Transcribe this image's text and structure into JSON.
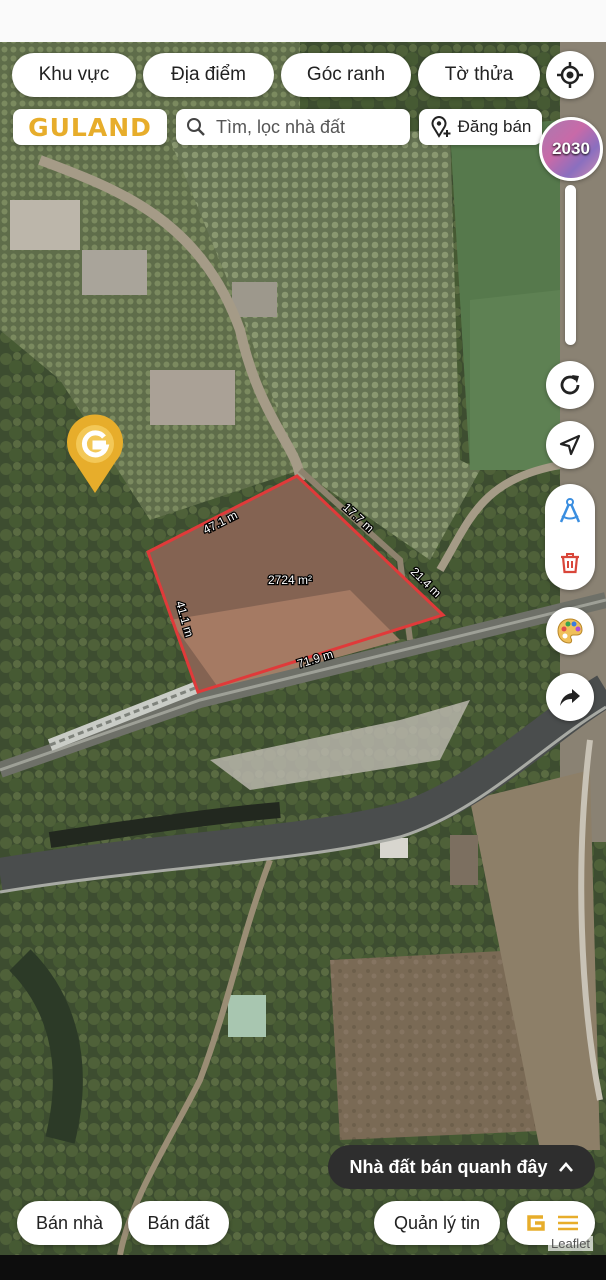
{
  "filters": {
    "region": "Khu vực",
    "location": "Địa điểm",
    "boundary": "Góc ranh",
    "parcel": "Tờ thửa"
  },
  "brand": {
    "logo_text": "GULAND"
  },
  "search": {
    "placeholder": "Tìm, lọc nhà đất"
  },
  "post_listing": {
    "label": "Đăng bán"
  },
  "planning_layer": {
    "label": "2030"
  },
  "parcel": {
    "area_label": "2724 m²",
    "edges": [
      "47.1 m",
      "17.7 m",
      "21.4 m",
      "71.9 m",
      "41.1 m"
    ],
    "outline_color": "#e03a3a"
  },
  "nearby_button": {
    "label": "Nhà đất bán quanh đây"
  },
  "bottom_bar": {
    "sell_house": "Bán nhà",
    "sell_land": "Bán đất",
    "manage_listings": "Quản lý tin"
  },
  "attribution": "Leaflet",
  "colors": {
    "brand_gold": "#e7ad2b",
    "delete_red": "#d9463a",
    "nav_blue": "#3b8ee0"
  }
}
